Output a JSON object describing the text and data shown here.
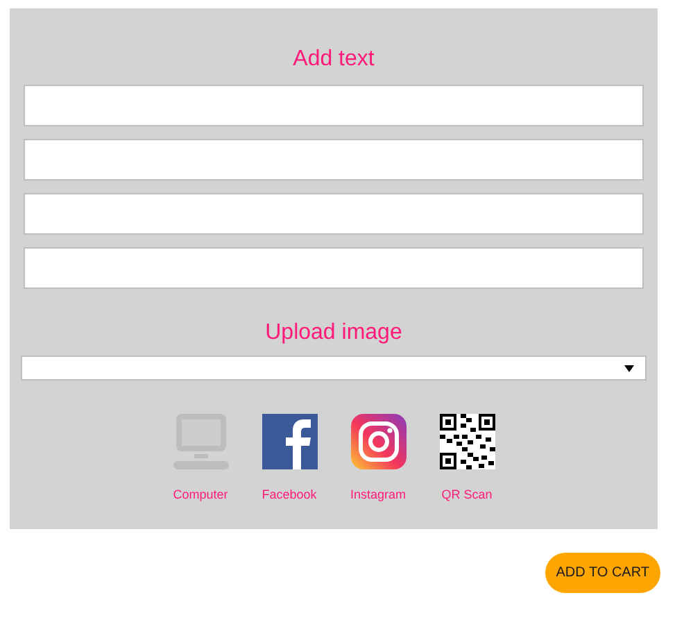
{
  "text_section": {
    "title": "Add text",
    "fields": [
      {
        "kind": "text"
      },
      {
        "kind": "text"
      },
      {
        "kind": "text"
      },
      {
        "kind": "text"
      }
    ]
  },
  "upload_section": {
    "title": "Upload image",
    "sources": [
      {
        "kind": "computer",
        "label": "Computer"
      },
      {
        "kind": "facebook",
        "label": "Facebook"
      },
      {
        "kind": "instagram",
        "label": "Instagram"
      },
      {
        "kind": "qr",
        "label": "QR Scan"
      }
    ]
  },
  "cart_button": "ADD TO CART"
}
